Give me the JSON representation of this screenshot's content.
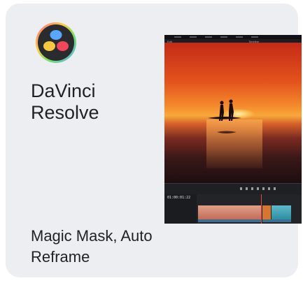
{
  "card": {
    "app_name": "DaVinci Resolve",
    "features": "Magic Mask, Auto Reframe",
    "logo_icon": "davinci-resolve-logo",
    "screenshot": {
      "topbar_left": "Edit",
      "topbar_right": "Timeline",
      "timecode": "01:00:01:22"
    }
  },
  "colors": {
    "card_background": "#eceef1",
    "text": "#1f2124",
    "editor_dark": "#18191c",
    "playhead": "#e34b3a"
  }
}
